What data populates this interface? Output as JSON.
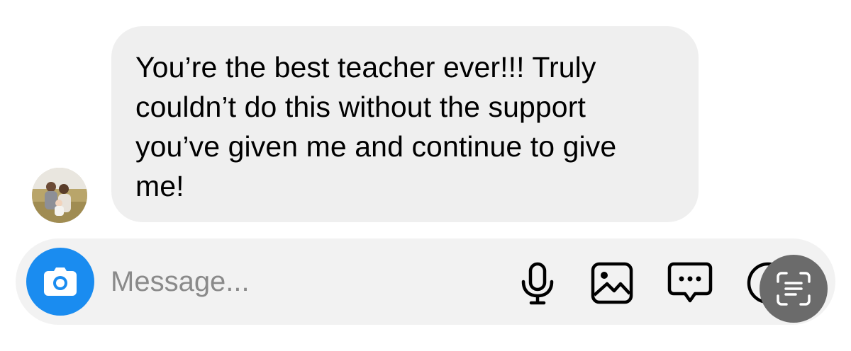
{
  "conversation": {
    "incoming_message": {
      "text": "You’re the best teacher ever!!! Truly\ncouldn’t do this without the support\nyou’ve given me and continue to give\nme!"
    },
    "sender": {
      "avatar": "avatar-photo-icon"
    }
  },
  "composer": {
    "placeholder": "Message...",
    "value": "",
    "icons": {
      "camera": "camera-icon",
      "microphone": "microphone-icon",
      "gallery": "gallery-icon",
      "sticker": "chat-bubble-icon",
      "more": "sticker-icon",
      "scan": "text-scan-icon"
    }
  },
  "colors": {
    "bubble": "#efefef",
    "composer": "#f2f2f2",
    "camera_button": "#1a8cf0",
    "scan_button": "#6b6b6b",
    "placeholder": "#8a8a8a"
  }
}
